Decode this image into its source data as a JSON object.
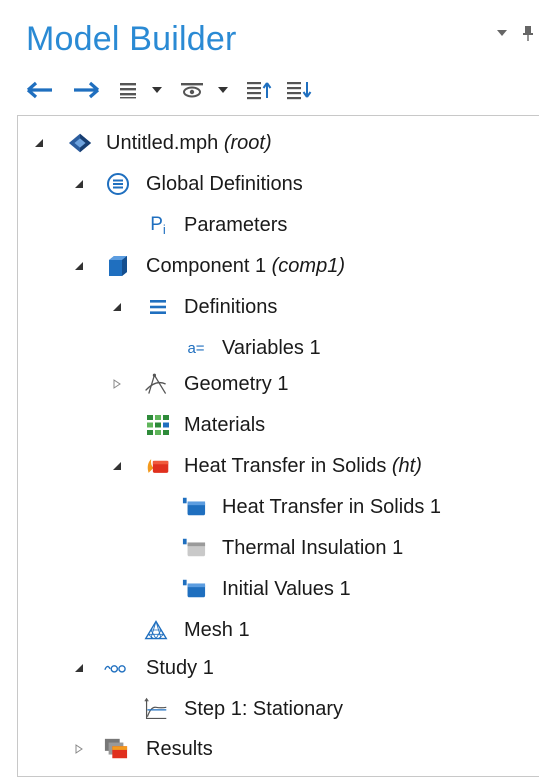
{
  "panel": {
    "title": "Model Builder"
  },
  "tree": {
    "root": {
      "label": "Untitled.mph",
      "tag": "(root)"
    },
    "global_definitions": {
      "label": "Global Definitions"
    },
    "parameters": {
      "label": "Parameters",
      "icon_text": "P",
      "icon_sub": "i"
    },
    "component": {
      "label": "Component 1",
      "tag": "(comp1)"
    },
    "definitions": {
      "label": "Definitions"
    },
    "variables": {
      "label": "Variables 1",
      "icon_text": "a="
    },
    "geometry": {
      "label": "Geometry 1"
    },
    "materials": {
      "label": "Materials"
    },
    "heat_transfer": {
      "label": "Heat Transfer in Solids",
      "tag": "(ht)"
    },
    "heat_transfer_1": {
      "label": "Heat Transfer in Solids 1"
    },
    "thermal_insulation": {
      "label": "Thermal Insulation 1"
    },
    "initial_values": {
      "label": "Initial Values 1"
    },
    "mesh": {
      "label": "Mesh 1"
    },
    "study": {
      "label": "Study 1"
    },
    "step": {
      "label": "Step 1: Stationary"
    },
    "results": {
      "label": "Results"
    }
  },
  "colors": {
    "title_blue": "#2a8ad4",
    "icon_blue": "#1f6fbf",
    "arrow_gray": "#555555"
  }
}
